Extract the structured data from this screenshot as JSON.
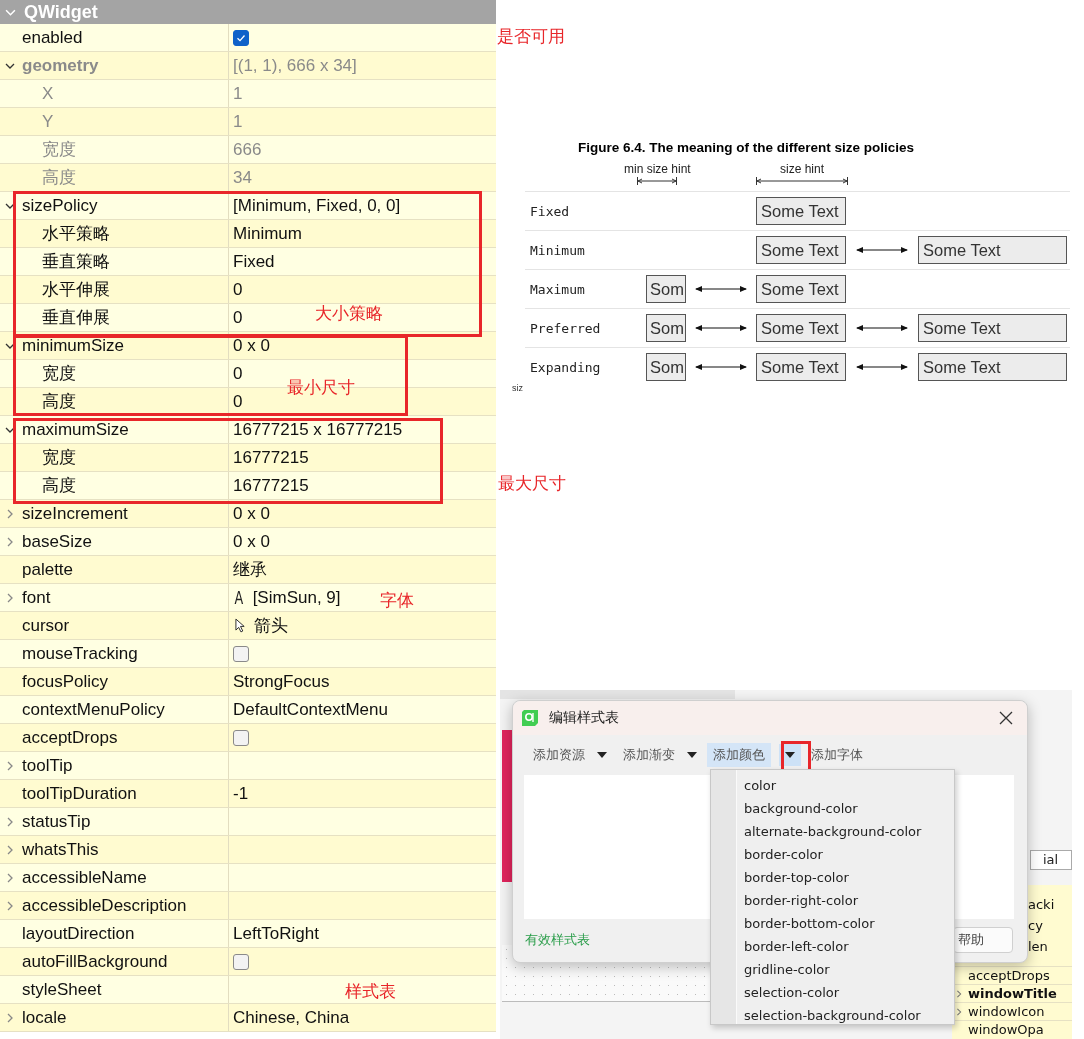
{
  "panel": {
    "title": "QWidget",
    "expanded": true,
    "properties": [
      {
        "name": "enabled",
        "kind": "checkbox",
        "checked": true,
        "modified": false,
        "disabled": false
      },
      {
        "name": "geometry",
        "kind": "text",
        "value": "[(1, 1), 666 x 34]",
        "modified": true,
        "disabled": true,
        "expanded": true,
        "children": [
          {
            "name": "X",
            "kind": "text",
            "value": "1",
            "modified": false,
            "disabled": true
          },
          {
            "name": "Y",
            "kind": "text",
            "value": "1",
            "modified": false,
            "disabled": true
          },
          {
            "name": "宽度",
            "kind": "text",
            "value": "666",
            "modified": false,
            "disabled": true
          },
          {
            "name": "高度",
            "kind": "text",
            "value": "34",
            "modified": false,
            "disabled": true
          }
        ]
      },
      {
        "name": "sizePolicy",
        "kind": "text",
        "value": "[Minimum, Fixed, 0, 0]",
        "modified": false,
        "disabled": false,
        "expanded": true,
        "children": [
          {
            "name": "水平策略",
            "kind": "text",
            "value": "Minimum",
            "modified": false,
            "disabled": false
          },
          {
            "name": "垂直策略",
            "kind": "text",
            "value": "Fixed",
            "modified": false,
            "disabled": false
          },
          {
            "name": "水平伸展",
            "kind": "text",
            "value": "0",
            "modified": false,
            "disabled": false
          },
          {
            "name": "垂直伸展",
            "kind": "text",
            "value": "0",
            "modified": false,
            "disabled": false
          }
        ]
      },
      {
        "name": "minimumSize",
        "kind": "text",
        "value": "0 x 0",
        "modified": false,
        "disabled": false,
        "expanded": true,
        "children": [
          {
            "name": "宽度",
            "kind": "text",
            "value": "0",
            "modified": false,
            "disabled": false
          },
          {
            "name": "高度",
            "kind": "text",
            "value": "0",
            "modified": false,
            "disabled": false
          }
        ]
      },
      {
        "name": "maximumSize",
        "kind": "text",
        "value": "16777215 x 16777215",
        "modified": false,
        "disabled": false,
        "expanded": true,
        "children": [
          {
            "name": "宽度",
            "kind": "text",
            "value": "16777215",
            "modified": false,
            "disabled": false
          },
          {
            "name": "高度",
            "kind": "text",
            "value": "16777215",
            "modified": false,
            "disabled": false
          }
        ]
      },
      {
        "name": "sizeIncrement",
        "kind": "text",
        "value": "0 x 0",
        "modified": false,
        "disabled": false,
        "expanded": false
      },
      {
        "name": "baseSize",
        "kind": "text",
        "value": "0 x 0",
        "modified": false,
        "disabled": false,
        "expanded": false
      },
      {
        "name": "palette",
        "kind": "text",
        "value": "继承",
        "modified": false,
        "disabled": false
      },
      {
        "name": "font",
        "kind": "font",
        "glyph": "A",
        "value": "[SimSun, 9]",
        "modified": false,
        "disabled": false,
        "expanded": false
      },
      {
        "name": "cursor",
        "kind": "cursor",
        "value": "箭头",
        "modified": false,
        "disabled": false
      },
      {
        "name": "mouseTracking",
        "kind": "checkbox",
        "checked": false,
        "modified": false,
        "disabled": false
      },
      {
        "name": "focusPolicy",
        "kind": "text",
        "value": "StrongFocus",
        "modified": false,
        "disabled": false
      },
      {
        "name": "contextMenuPolicy",
        "kind": "text",
        "value": "DefaultContextMenu",
        "modified": false,
        "disabled": false
      },
      {
        "name": "acceptDrops",
        "kind": "checkbox",
        "checked": false,
        "modified": false,
        "disabled": false
      },
      {
        "name": "toolTip",
        "kind": "text",
        "modified": false,
        "disabled": false,
        "expanded": false
      },
      {
        "name": "toolTipDuration",
        "kind": "text",
        "value": "-1",
        "modified": false,
        "disabled": false
      },
      {
        "name": "statusTip",
        "kind": "text",
        "modified": false,
        "disabled": false,
        "expanded": false
      },
      {
        "name": "whatsThis",
        "kind": "text",
        "modified": false,
        "disabled": false,
        "expanded": false
      },
      {
        "name": "accessibleName",
        "kind": "text",
        "modified": false,
        "disabled": false,
        "expanded": false
      },
      {
        "name": "accessibleDescription",
        "kind": "text",
        "modified": false,
        "disabled": false,
        "expanded": false
      },
      {
        "name": "layoutDirection",
        "kind": "text",
        "value": "LeftToRight",
        "modified": false,
        "disabled": false
      },
      {
        "name": "autoFillBackground",
        "kind": "checkbox",
        "checked": false,
        "modified": false,
        "disabled": false
      },
      {
        "name": "styleSheet",
        "kind": "text",
        "modified": false,
        "disabled": false
      },
      {
        "name": "locale",
        "kind": "text",
        "value": "Chinese, China",
        "modified": false,
        "disabled": false,
        "expanded": false
      }
    ]
  },
  "annotations": [
    "是否可用",
    "大小策略",
    "最小尺寸",
    "最大尺寸",
    "字体",
    "样式表"
  ],
  "figure": {
    "title": "Figure 6.4. The meaning of the different size policies",
    "min_hint_label": "min size hint",
    "hint_label": "size hint",
    "footnote": "siz",
    "rows": [
      {
        "policy": "Fixed",
        "hint_box": "Some Text"
      },
      {
        "policy": "Minimum",
        "hint_box": "Some Text",
        "max_box": "Some Text"
      },
      {
        "policy": "Maximum",
        "min_box": "Som",
        "hint_box": "Some Text"
      },
      {
        "policy": "Preferred",
        "min_box": "Som",
        "hint_box": "Some Text",
        "max_box": "Some Text"
      },
      {
        "policy": "Expanding",
        "min_box": "Som",
        "hint_box": "Some Text",
        "max_box": "Some Text"
      }
    ]
  },
  "dialog": {
    "title": "编辑样式表",
    "toolbar": [
      {
        "label": "添加资源",
        "selected": false,
        "dropdown": true
      },
      {
        "label": "添加渐变",
        "selected": false,
        "dropdown": true
      },
      {
        "label": "添加颜色",
        "selected": true,
        "dropdown": true
      },
      {
        "label": "添加字体",
        "selected": false,
        "dropdown": false
      }
    ],
    "status": "有效样式表",
    "help_button": "帮助",
    "menu": [
      "color",
      "background-color",
      "alternate-background-color",
      "border-color",
      "border-top-color",
      "border-right-color",
      "border-bottom-color",
      "border-left-color",
      "gridline-color",
      "selection-color",
      "selection-background-color"
    ],
    "background_tab": "ial",
    "background_cut_rows": [
      "acki",
      "cy",
      "len"
    ],
    "background_rows": [
      {
        "name": "acceptDrops",
        "modified": false,
        "expanded": null
      },
      {
        "name": "windowTitle",
        "modified": true,
        "expanded": false
      },
      {
        "name": "windowIcon",
        "modified": false,
        "expanded": false
      },
      {
        "name": "windowOpa",
        "modified": false,
        "expanded": null
      }
    ]
  }
}
